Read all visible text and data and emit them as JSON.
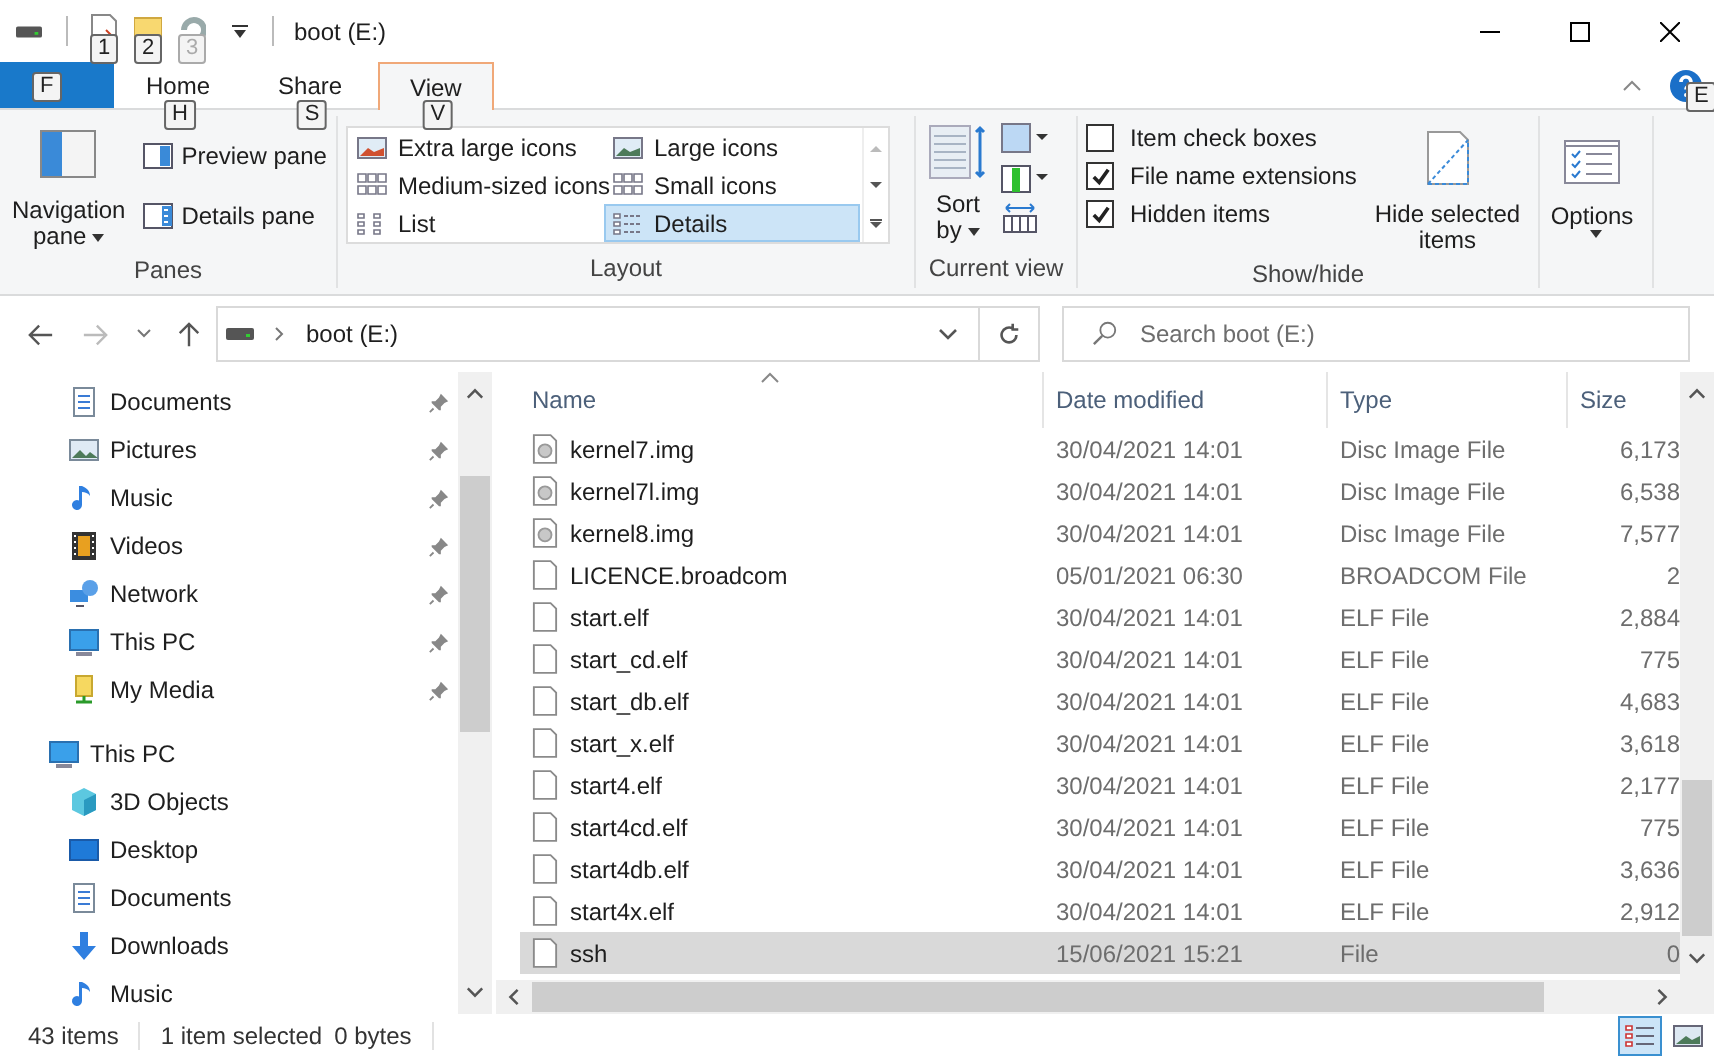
{
  "title_bar": {
    "title": "boot (E:)",
    "keytips": [
      "1",
      "2",
      "3"
    ]
  },
  "ribbon_tabs": [
    {
      "kind": "file",
      "keytip": "F",
      "selected": false
    },
    {
      "kind": "tab",
      "label": "Home",
      "keytip": "H",
      "selected": false
    },
    {
      "kind": "tab",
      "label": "Share",
      "keytip": "S",
      "selected": false
    },
    {
      "kind": "tab",
      "label": "View",
      "keytip": "V",
      "selected": true
    }
  ],
  "help_keytip": "E",
  "ribbon": {
    "panes": {
      "label": "Panes",
      "navigation_pane": "Navigation pane",
      "items": [
        {
          "label": "Preview pane",
          "kind": "preview"
        },
        {
          "label": "Details pane",
          "kind": "details"
        }
      ]
    },
    "layout": {
      "label": "Layout",
      "options": [
        {
          "label": "Extra large icons",
          "kind": "xl",
          "selected": false
        },
        {
          "label": "Large icons",
          "kind": "large",
          "selected": false
        },
        {
          "label": "Medium-sized icons",
          "kind": "medium",
          "selected": false
        },
        {
          "label": "Small icons",
          "kind": "small",
          "selected": false
        },
        {
          "label": "List",
          "kind": "list",
          "selected": false
        },
        {
          "label": "Details",
          "kind": "details",
          "selected": true
        }
      ]
    },
    "current_view": {
      "label": "Current view",
      "sort_by": "Sort by"
    },
    "show_hide": {
      "label": "Show/hide",
      "checkboxes": [
        {
          "label": "Item check boxes",
          "checked": false
        },
        {
          "label": "File name extensions",
          "checked": true
        },
        {
          "label": "Hidden items",
          "checked": true
        }
      ],
      "hide_selected": "Hide selected items"
    },
    "options": "Options"
  },
  "address": {
    "path": "boot (E:)"
  },
  "search": {
    "placeholder": "Search boot (E:)"
  },
  "navigation": {
    "quick_access": [
      {
        "label": "Documents",
        "kind": "documents",
        "pinned": true
      },
      {
        "label": "Pictures",
        "kind": "pictures",
        "pinned": true
      },
      {
        "label": "Music",
        "kind": "music",
        "pinned": true
      },
      {
        "label": "Videos",
        "kind": "videos",
        "pinned": true
      },
      {
        "label": "Network",
        "kind": "network",
        "pinned": true
      },
      {
        "label": "This PC",
        "kind": "pc",
        "pinned": true
      },
      {
        "label": "My Media",
        "kind": "media",
        "pinned": true
      }
    ],
    "this_pc": {
      "label": "This PC",
      "kind": "pc",
      "children": [
        {
          "label": "3D Objects",
          "kind": "objects"
        },
        {
          "label": "Desktop",
          "kind": "desktop"
        },
        {
          "label": "Documents",
          "kind": "documents"
        },
        {
          "label": "Downloads",
          "kind": "downloads"
        },
        {
          "label": "Music",
          "kind": "music"
        }
      ]
    }
  },
  "file_list": {
    "columns": [
      {
        "label": "Name",
        "sorted": true
      },
      {
        "label": "Date modified",
        "sorted": false
      },
      {
        "label": "Type",
        "sorted": false
      },
      {
        "label": "Size",
        "sorted": false
      }
    ],
    "rows": [
      {
        "name": "kernel7.img",
        "date": "30/04/2021 14:01",
        "type": "Disc Image File",
        "size": "6,173",
        "kind": "disc",
        "selected": false
      },
      {
        "name": "kernel7l.img",
        "date": "30/04/2021 14:01",
        "type": "Disc Image File",
        "size": "6,538",
        "kind": "disc",
        "selected": false
      },
      {
        "name": "kernel8.img",
        "date": "30/04/2021 14:01",
        "type": "Disc Image File",
        "size": "7,577",
        "kind": "disc",
        "selected": false
      },
      {
        "name": "LICENCE.broadcom",
        "date": "05/01/2021 06:30",
        "type": "BROADCOM File",
        "size": "2",
        "kind": "file",
        "selected": false
      },
      {
        "name": "start.elf",
        "date": "30/04/2021 14:01",
        "type": "ELF File",
        "size": "2,884",
        "kind": "file",
        "selected": false
      },
      {
        "name": "start_cd.elf",
        "date": "30/04/2021 14:01",
        "type": "ELF File",
        "size": "775",
        "kind": "file",
        "selected": false
      },
      {
        "name": "start_db.elf",
        "date": "30/04/2021 14:01",
        "type": "ELF File",
        "size": "4,683",
        "kind": "file",
        "selected": false
      },
      {
        "name": "start_x.elf",
        "date": "30/04/2021 14:01",
        "type": "ELF File",
        "size": "3,618",
        "kind": "file",
        "selected": false
      },
      {
        "name": "start4.elf",
        "date": "30/04/2021 14:01",
        "type": "ELF File",
        "size": "2,177",
        "kind": "file",
        "selected": false
      },
      {
        "name": "start4cd.elf",
        "date": "30/04/2021 14:01",
        "type": "ELF File",
        "size": "775",
        "kind": "file",
        "selected": false
      },
      {
        "name": "start4db.elf",
        "date": "30/04/2021 14:01",
        "type": "ELF File",
        "size": "3,636",
        "kind": "file",
        "selected": false
      },
      {
        "name": "start4x.elf",
        "date": "30/04/2021 14:01",
        "type": "ELF File",
        "size": "2,912",
        "kind": "file",
        "selected": false
      },
      {
        "name": "ssh",
        "date": "15/06/2021 15:21",
        "type": "File",
        "size": "0",
        "kind": "file",
        "selected": true
      }
    ]
  },
  "status_bar": {
    "item_count": "43 items",
    "selection": "1 item selected",
    "size": "0 bytes",
    "views": [
      {
        "kind": "details",
        "selected": true
      },
      {
        "kind": "large_icons",
        "selected": false
      }
    ]
  }
}
